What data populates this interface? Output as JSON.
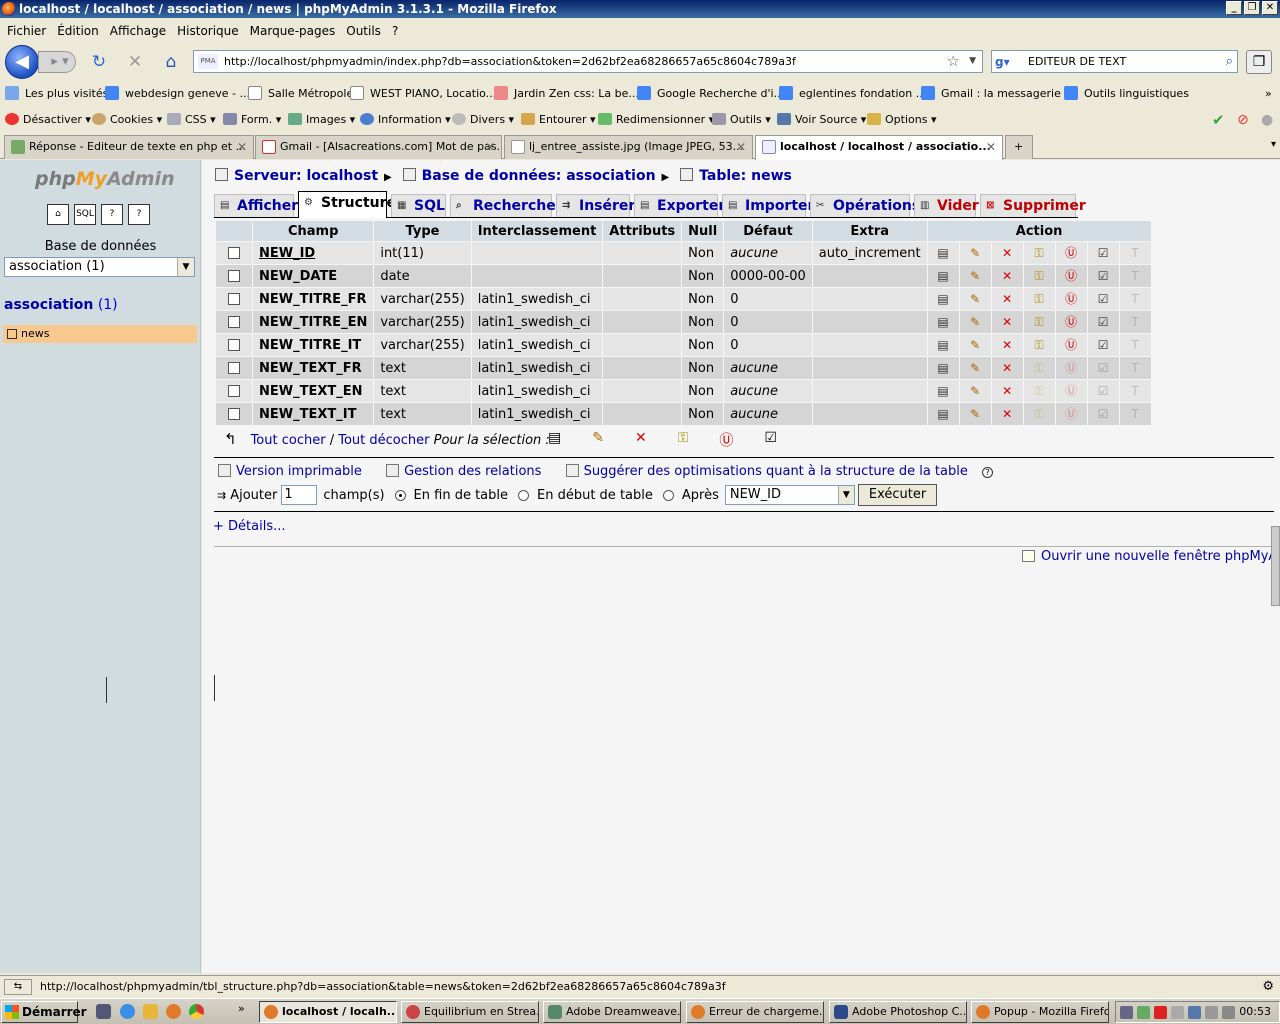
{
  "window": {
    "title": "localhost / localhost / association / news | phpMyAdmin 3.1.3.1 - Mozilla Firefox"
  },
  "menu": [
    "Fichier",
    "Édition",
    "Affichage",
    "Historique",
    "Marque-pages",
    "Outils",
    "?"
  ],
  "nav": {
    "url": "http://localhost/phpmyadmin/index.php?db=association&token=2d62bf2ea68286657a65c8604c789a3f",
    "search_value": "EDITEUR DE TEXT"
  },
  "bookmarks": [
    "Les plus visités",
    "webdesign geneve - ...",
    "Salle Métropole",
    "WEST PIANO, Locatio...",
    "Jardin Zen css: La be...",
    "Google Recherche d'i...",
    "eglentines fondation ...",
    "Gmail : la messagerie ...",
    "Outils linguistiques"
  ],
  "devbar": [
    "Désactiver",
    "Cookies",
    "CSS",
    "Form.",
    "Images",
    "Information",
    "Divers",
    "Entourer",
    "Redimensionner",
    "Outils",
    "Voir Source",
    "Options"
  ],
  "tabs": [
    {
      "label": "Réponse - Editeur de texte en php et ...",
      "active": false
    },
    {
      "label": "Gmail - [Alsacreations.com] Mot de pas...",
      "active": false
    },
    {
      "label": "lj_entree_assiste.jpg (Image JPEG, 53...",
      "active": false
    },
    {
      "label": "localhost / localhost / associatio...",
      "active": true
    }
  ],
  "sidebar": {
    "db_label": "Base de données",
    "db_select": "association (1)",
    "db_name": "association",
    "db_count": "(1)",
    "table": "news"
  },
  "breadcrumb": {
    "server": "Serveur: localhost",
    "database": "Base de données: association",
    "table": "Table: news"
  },
  "subtabs": [
    "Afficher",
    "Structure",
    "SQL",
    "Rechercher",
    "Insérer",
    "Exporter",
    "Importer",
    "Opérations",
    "Vider",
    "Supprimer"
  ],
  "table": {
    "headers": [
      "Champ",
      "Type",
      "Interclassement",
      "Attributs",
      "Null",
      "Défaut",
      "Extra",
      "Action"
    ],
    "rows": [
      {
        "name": "NEW_ID",
        "type": "int(11)",
        "collation": "",
        "attributes": "",
        "null": "Non",
        "default": "aucune",
        "extra": "auto_increment"
      },
      {
        "name": "NEW_DATE",
        "type": "date",
        "collation": "",
        "attributes": "",
        "null": "Non",
        "default": "0000-00-00",
        "extra": ""
      },
      {
        "name": "NEW_TITRE_FR",
        "type": "varchar(255)",
        "collation": "latin1_swedish_ci",
        "attributes": "",
        "null": "Non",
        "default": "0",
        "extra": ""
      },
      {
        "name": "NEW_TITRE_EN",
        "type": "varchar(255)",
        "collation": "latin1_swedish_ci",
        "attributes": "",
        "null": "Non",
        "default": "0",
        "extra": ""
      },
      {
        "name": "NEW_TITRE_IT",
        "type": "varchar(255)",
        "collation": "latin1_swedish_ci",
        "attributes": "",
        "null": "Non",
        "default": "0",
        "extra": ""
      },
      {
        "name": "NEW_TEXT_FR",
        "type": "text",
        "collation": "latin1_swedish_ci",
        "attributes": "",
        "null": "Non",
        "default": "aucune",
        "extra": ""
      },
      {
        "name": "NEW_TEXT_EN",
        "type": "text",
        "collation": "latin1_swedish_ci",
        "attributes": "",
        "null": "Non",
        "default": "aucune",
        "extra": ""
      },
      {
        "name": "NEW_TEXT_IT",
        "type": "text",
        "collation": "latin1_swedish_ci",
        "attributes": "",
        "null": "Non",
        "default": "aucune",
        "extra": ""
      }
    ]
  },
  "selection": {
    "check_all": "Tout cocher",
    "sep": "/",
    "uncheck_all": "Tout décocher",
    "for_selection": "Pour la sélection :"
  },
  "links": {
    "print": "Version imprimable",
    "relations": "Gestion des relations",
    "optimize": "Suggérer des optimisations quant à la structure de la table"
  },
  "add_field": {
    "label": "Ajouter",
    "count": "1",
    "unit": "champ(s)",
    "end": "En fin de table",
    "start": "En début de table",
    "after": "Après",
    "after_field": "NEW_ID",
    "execute": "Exécuter"
  },
  "details": "+ Détails...",
  "new_window": "Ouvrir une nouvelle fenêtre phpMyAdmin",
  "status_url": "http://localhost/phpmyadmin/tbl_structure.php?db=association&table=news&token=2d62bf2ea68286657a65c8604c789a3f",
  "taskbar": {
    "start": "Démarrer",
    "items": [
      "localhost / localh...",
      "Equilibrium en Strea...",
      "Adobe Dreamweave...",
      "Erreur de chargeme...",
      "Adobe Photoshop C...",
      "Popup - Mozilla Firefox"
    ],
    "clock": "00:53"
  }
}
